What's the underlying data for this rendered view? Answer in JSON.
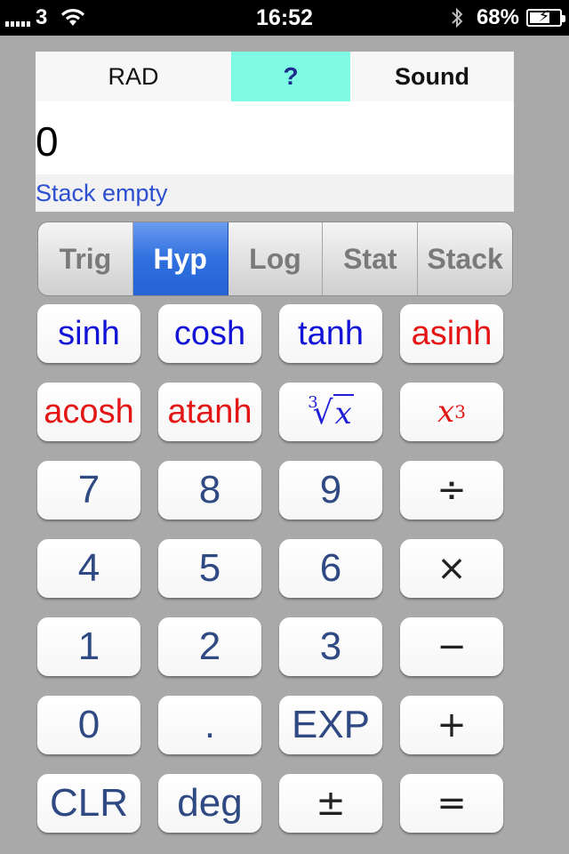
{
  "status_bar": {
    "carrier": "3",
    "time": "16:52",
    "battery": "68%",
    "battery_fraction": 0.68
  },
  "top_bar": {
    "angle_mode": "RAD",
    "help": "?",
    "sound": "Sound"
  },
  "display": {
    "value": "0",
    "stack_status": "Stack empty"
  },
  "tabs": [
    {
      "label": "Trig",
      "active": false
    },
    {
      "label": "Hyp",
      "active": true
    },
    {
      "label": "Log",
      "active": false
    },
    {
      "label": "Stat",
      "active": false
    },
    {
      "label": "Stack",
      "active": false
    }
  ],
  "keys": {
    "sinh": "sinh",
    "cosh": "cosh",
    "tanh": "tanh",
    "asinh": "asinh",
    "acosh": "acosh",
    "atanh": "atanh",
    "cube_root_index": "3",
    "cube_root_var": "x",
    "cube_var": "x",
    "cube_exp": "3",
    "seven": "7",
    "eight": "8",
    "nine": "9",
    "divide": "÷",
    "four": "4",
    "five": "5",
    "six": "6",
    "multiply": "×",
    "one": "1",
    "two": "2",
    "three": "3",
    "minus": "−",
    "zero": "0",
    "decimal": ".",
    "exp": "EXP",
    "plus": "+",
    "clear": "CLR",
    "deg": "deg",
    "plus_minus": "±",
    "equals": "="
  },
  "colors": {
    "help_bg": "#7ffbe4",
    "active_tab": "#2f6fde",
    "function_blue": "#1313d8",
    "function_red": "#e31515",
    "digit": "#2f4a82",
    "stack_text": "#2c4fcf"
  }
}
